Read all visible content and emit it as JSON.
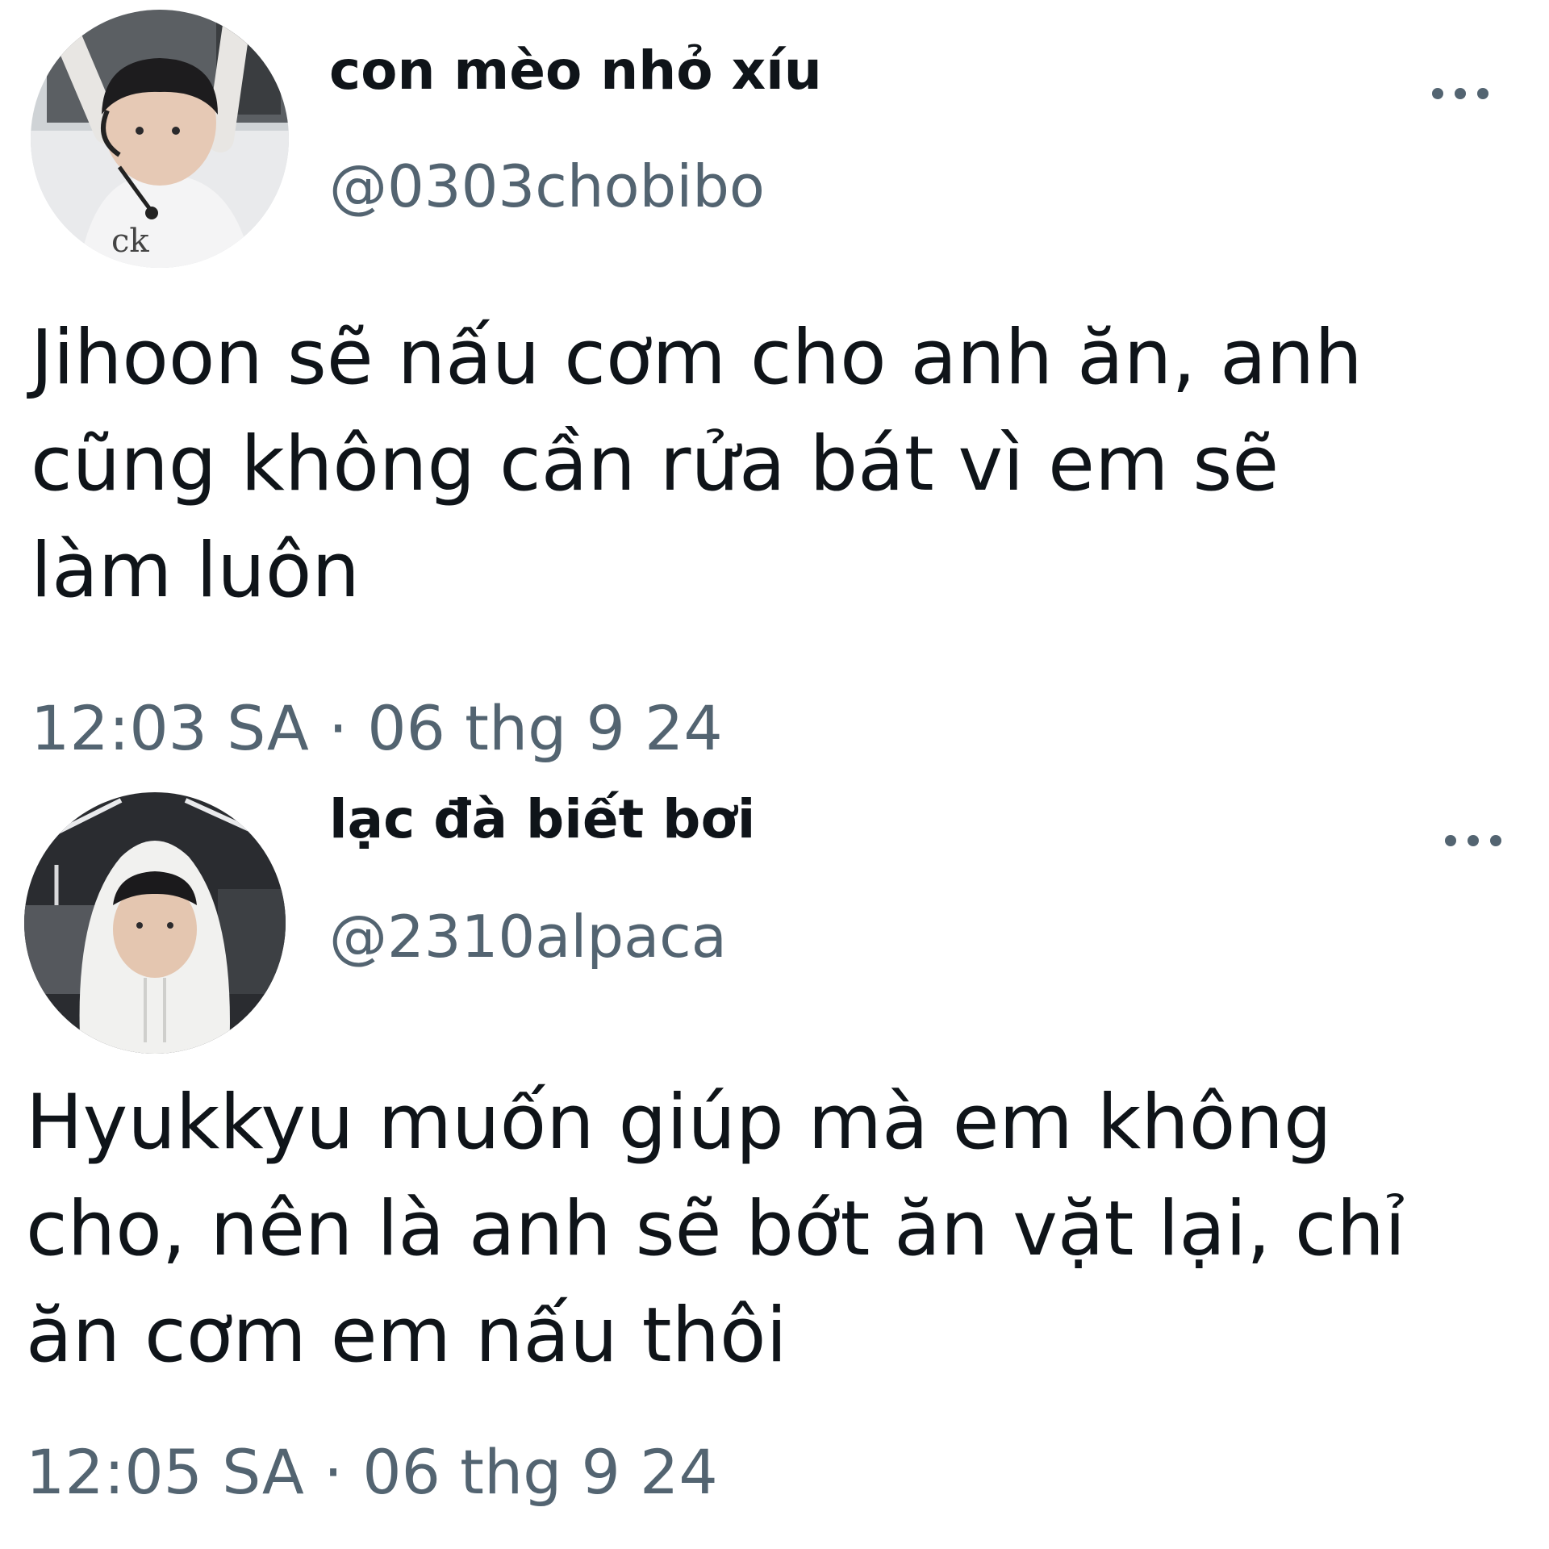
{
  "tweets": [
    {
      "display_name": "con mèo nhỏ xíu",
      "handle": "@0303chobibo",
      "text": "Jihoon sẽ nấu cơm cho anh ăn, anh\ncũng không cần rửa bát vì em sẽ\nlàm luôn",
      "timestamp": "12:03 SA · 06 thg 9 24",
      "more_icon": "more-horizontal-icon"
    },
    {
      "display_name": "lạc đà biết bơi",
      "handle": "@2310alpaca",
      "text": "Hyukkyu muốn giúp mà em không\ncho, nên là anh sẽ bớt ăn vặt lại, chỉ\năn cơm em nấu thôi",
      "timestamp": "12:05 SA · 06 thg 9 24",
      "more_icon": "more-horizontal-icon"
    }
  ],
  "colors": {
    "primary_text": "#0f1419",
    "secondary_text": "#536471",
    "background": "#ffffff"
  }
}
